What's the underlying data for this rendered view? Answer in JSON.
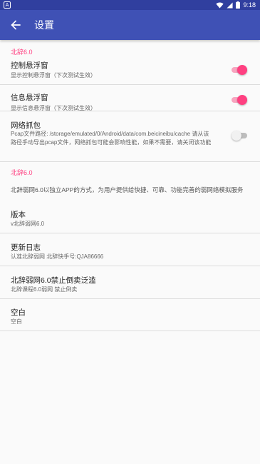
{
  "status_bar": {
    "app_icon": "A",
    "time": "9:18"
  },
  "toolbar": {
    "title": "设置"
  },
  "section1": {
    "title": "北辞6.0",
    "items": [
      {
        "title": "控制悬浮窗",
        "summary": "显示控制悬浮窗（下次测试生效）",
        "checked": true
      },
      {
        "title": "信息悬浮窗",
        "summary": "显示信息悬浮窗（下次测试生效）",
        "checked": true
      },
      {
        "title": "网络抓包",
        "summary": "Pcap文件路径: /storage/emulated/0/Android/data/com.beicineibu/cache 请从该路径手动导出pcap文件，网络抓包可能会影响性能，如果不需要，请关闭该功能",
        "checked": false
      }
    ]
  },
  "section2": {
    "title": "北辞6.0",
    "description": "北辞弱网6.0以独立APP的方式，为用户提供给快捷、可靠、功能完善的弱网络模拟服务",
    "items": [
      {
        "title": "版本",
        "summary": "v北辞弱网6.0"
      },
      {
        "title": "更新日志",
        "summary": "认准北辞弱网 北辞快手号:QJA86666"
      },
      {
        "title": "北辞弱网6.0禁止倒卖泛滥",
        "summary": "北辞课程6.0弱网 禁止倒卖"
      },
      {
        "title": "空白",
        "summary": "空白"
      }
    ]
  },
  "colors": {
    "primary": "#3f51b5",
    "primary_dark": "#303f9f",
    "accent": "#ff4081"
  }
}
